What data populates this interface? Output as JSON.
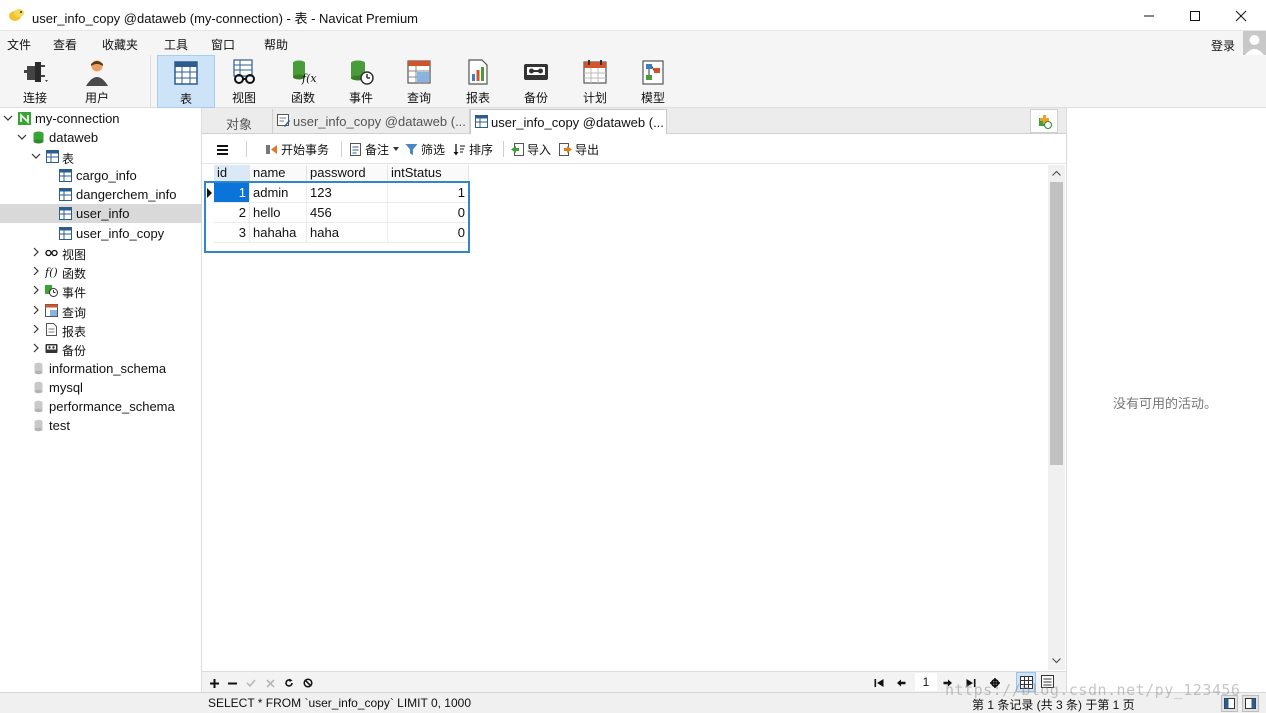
{
  "window": {
    "title": "user_info_copy @dataweb (my-connection) - 表 - Navicat Premium"
  },
  "menu": {
    "items": [
      "文件",
      "查看",
      "收藏夹",
      "工具",
      "窗口",
      "帮助"
    ],
    "login": "登录"
  },
  "toolbar": {
    "connect": "连接",
    "user": "用户",
    "table": "表",
    "view": "视图",
    "function": "函数",
    "event": "事件",
    "query": "查询",
    "report": "报表",
    "backup": "备份",
    "schedule": "计划",
    "model": "模型",
    "active": "表"
  },
  "sidebar": {
    "connection": "my-connection",
    "database": "dataweb",
    "tables_group": "表",
    "tables": [
      "cargo_info",
      "dangerchem_info",
      "user_info",
      "user_info_copy"
    ],
    "selected_table": "user_info",
    "groups": [
      "视图",
      "函数",
      "事件",
      "查询",
      "报表",
      "备份"
    ],
    "other_databases": [
      "information_schema",
      "mysql",
      "performance_schema",
      "test"
    ]
  },
  "tabs": {
    "objects": "对象",
    "tab1": "user_info_copy @dataweb (...",
    "tab2": "user_info_copy @dataweb (..."
  },
  "object_toolbar": {
    "begin_transaction": "开始事务",
    "note": "备注",
    "filter": "筛选",
    "sort": "排序",
    "import": "导入",
    "export": "导出"
  },
  "grid": {
    "columns": [
      "id",
      "name",
      "password",
      "intStatus"
    ],
    "rows": [
      {
        "id": "1",
        "name": "admin",
        "password": "123",
        "intStatus": "1"
      },
      {
        "id": "2",
        "name": "hello",
        "password": "456",
        "intStatus": "0"
      },
      {
        "id": "3",
        "name": "hahaha",
        "password": "haha",
        "intStatus": "0"
      }
    ],
    "current_row": 1
  },
  "navigation": {
    "page": "1"
  },
  "right_panel": {
    "message": "没有可用的活动。"
  },
  "status": {
    "sql": "SELECT * FROM `user_info_copy` LIMIT 0, 1000",
    "records": "第 1 条记录 (共 3 条) 于第 1 页"
  },
  "watermark": "https://blog.csdn.net/py_123456",
  "colors": {
    "accent": "#0a74da",
    "highlight_box": "#2f86c8",
    "toolbar_active": "#cde3f7",
    "sidebar_selected": "#d9d9d9",
    "database_icon": "#3aa335"
  }
}
